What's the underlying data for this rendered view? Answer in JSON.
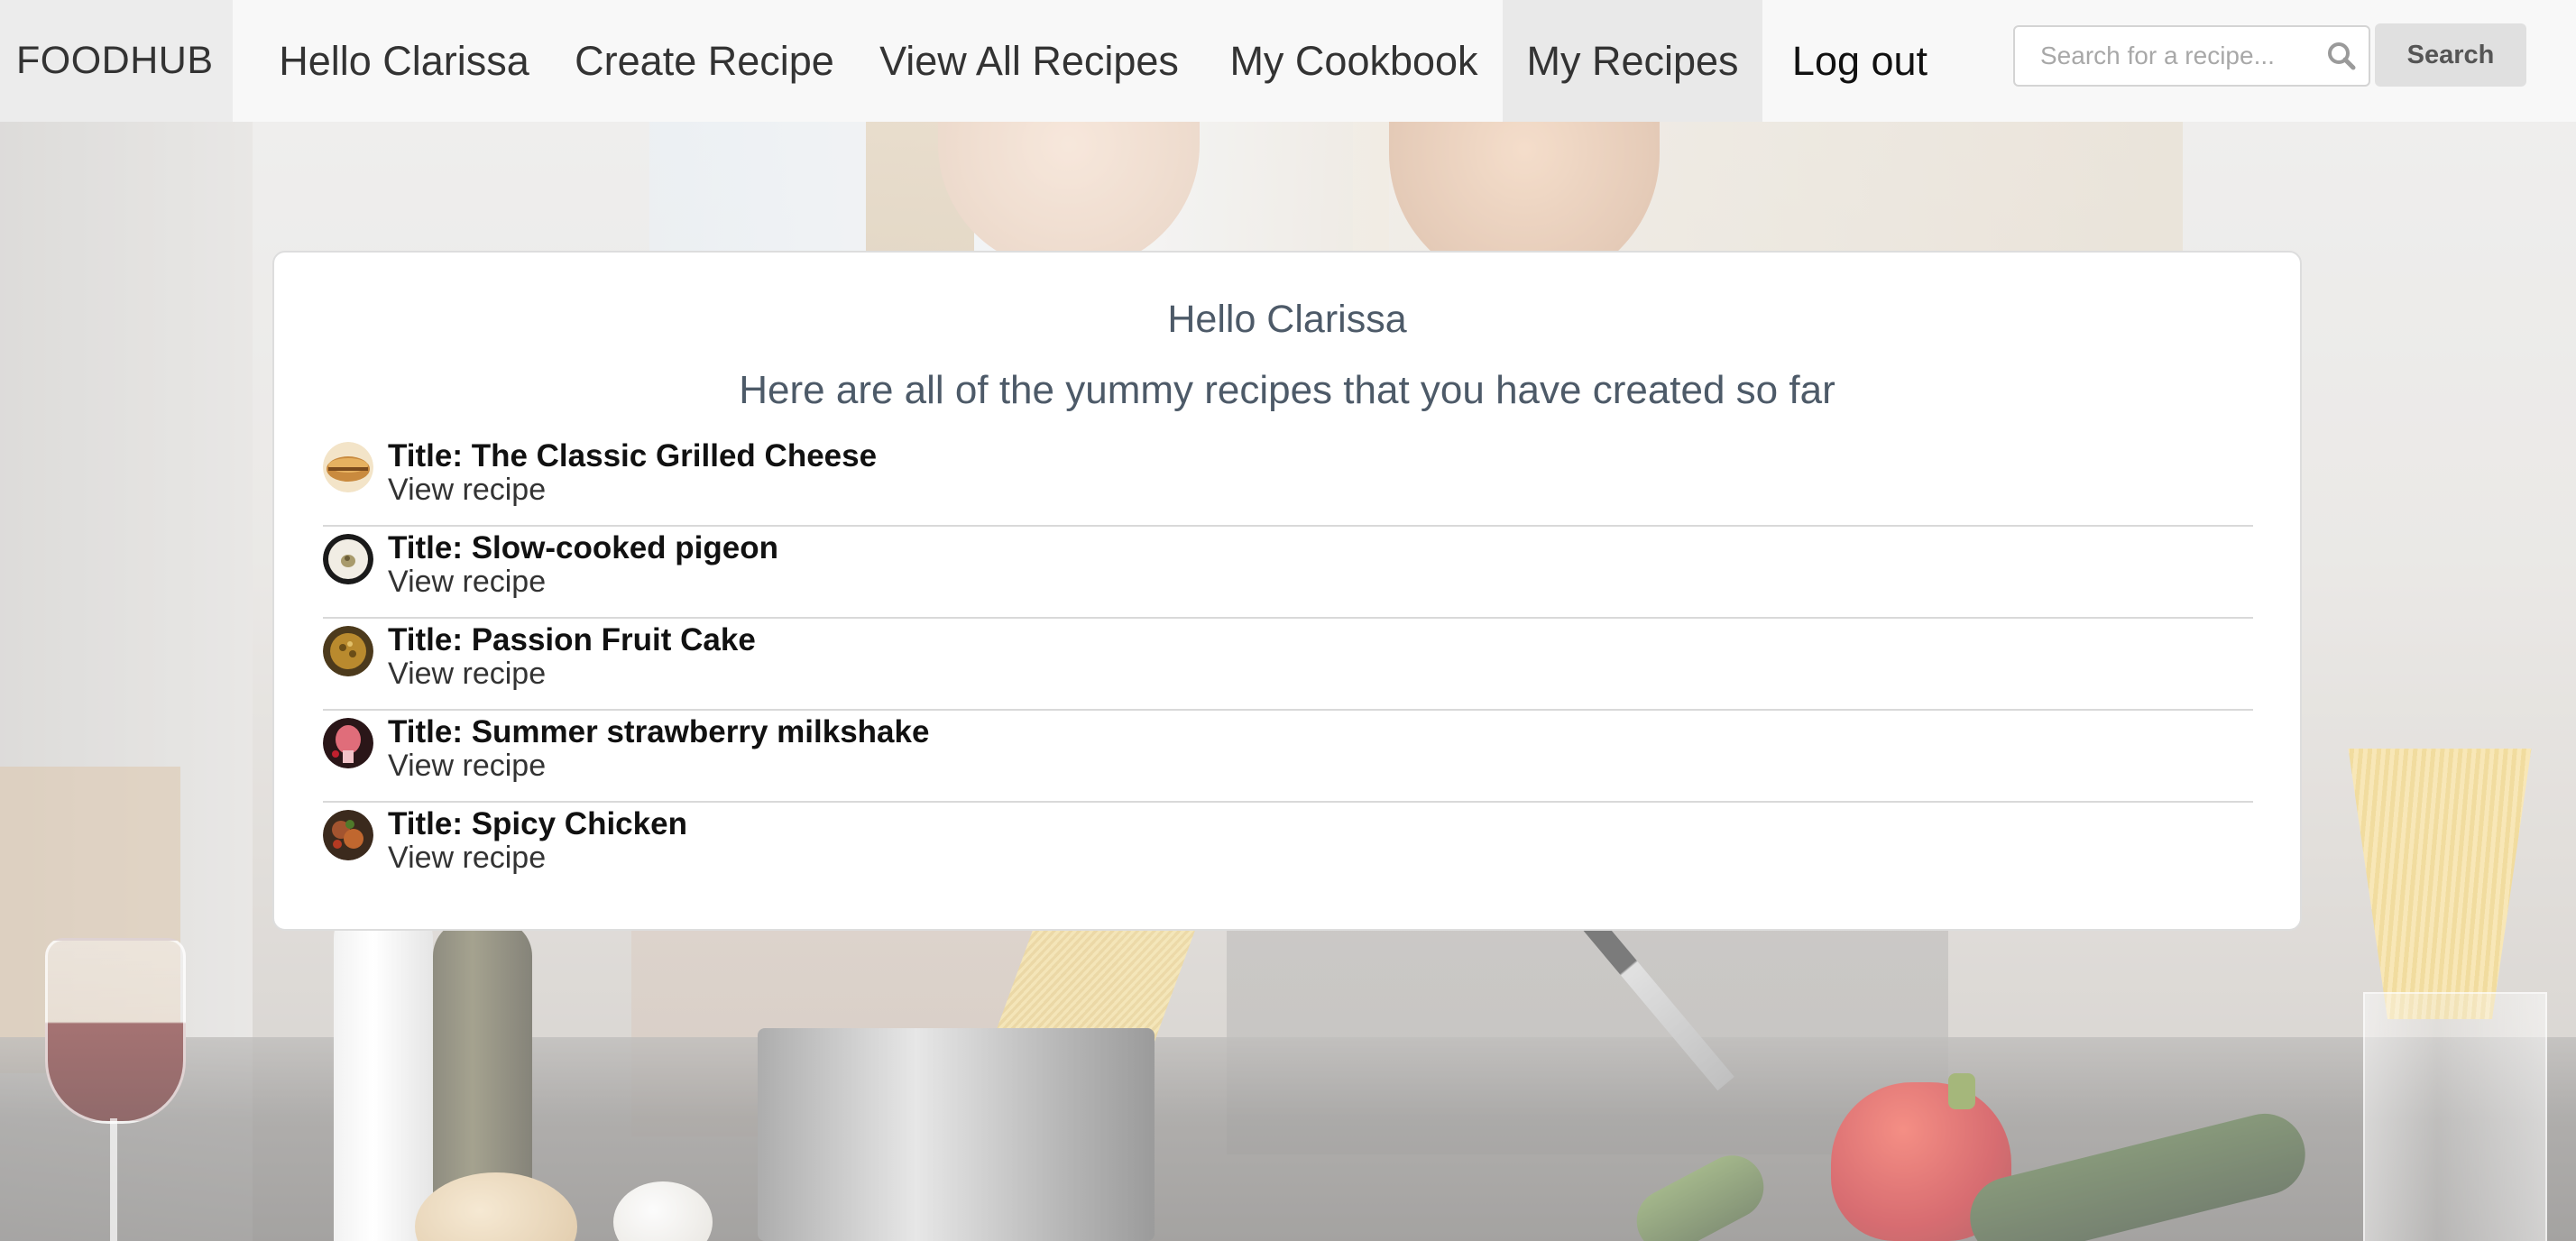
{
  "navbar": {
    "brand": "FOODHUB",
    "items": [
      {
        "label": "Hello Clarissa"
      },
      {
        "label": "Create Recipe"
      },
      {
        "label": "View All Recipes"
      },
      {
        "label": "My Cookbook"
      },
      {
        "label": "My Recipes",
        "active": true
      },
      {
        "label": "Log out"
      }
    ],
    "search": {
      "placeholder": "Search for a recipe...",
      "value": "",
      "icon": "search-icon",
      "button_label": "Search"
    }
  },
  "main": {
    "greeting": "Hello Clarissa",
    "subtitle": "Here are all of the yummy recipes that you have created so far",
    "recipes": [
      {
        "title": "Title: The Classic Grilled Cheese",
        "link": "View recipe",
        "thumb_colors": [
          "#c98a3e",
          "#7a4a1c"
        ]
      },
      {
        "title": "Title: Slow-cooked pigeon",
        "link": "View recipe",
        "thumb_colors": [
          "#f1ede4",
          "#1a1a1a"
        ]
      },
      {
        "title": "Title: Passion Fruit Cake",
        "link": "View recipe",
        "thumb_colors": [
          "#b98a2e",
          "#4c3a1c"
        ]
      },
      {
        "title": "Title: Summer strawberry milkshake",
        "link": "View recipe",
        "thumb_colors": [
          "#e06d7a",
          "#2a1618"
        ]
      },
      {
        "title": "Title: Spicy Chicken",
        "link": "View recipe",
        "thumb_colors": [
          "#a3542f",
          "#3b2a1d"
        ]
      }
    ]
  },
  "colors": {
    "navbar_bg": "#f8f8f8",
    "active_nav_bg": "#e9e9e9",
    "heading_text": "#4d5a68",
    "card_bg": "#ffffff"
  }
}
